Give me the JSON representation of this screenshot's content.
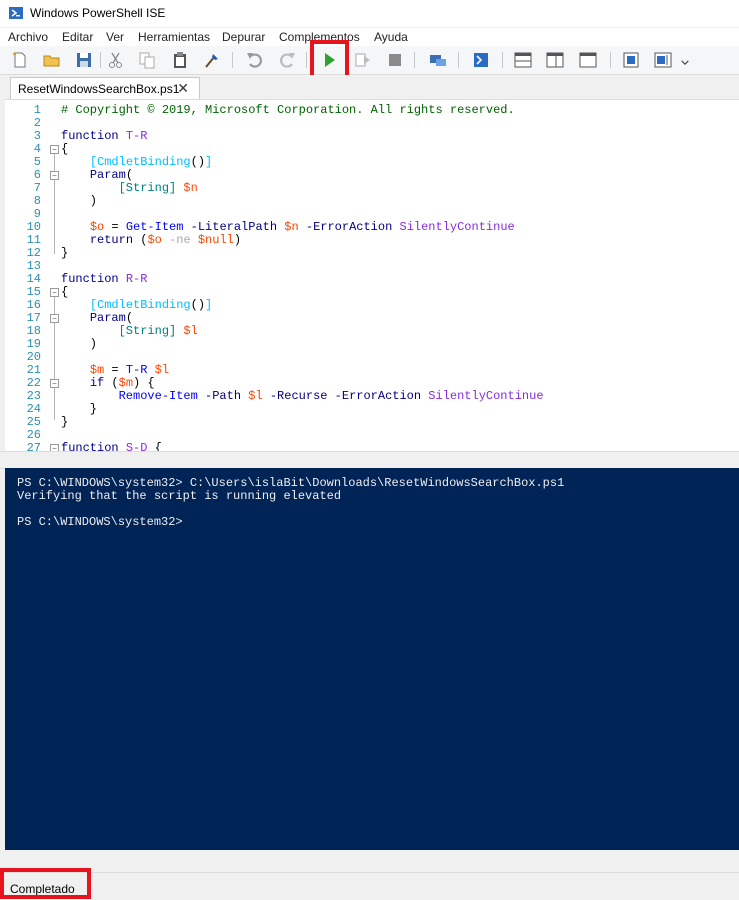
{
  "window": {
    "title": "Windows PowerShell ISE"
  },
  "menu": [
    "Archivo",
    "Editar",
    "Ver",
    "Herramientas",
    "Depurar",
    "Complementos",
    "Ayuda"
  ],
  "toolbar": {
    "icons": [
      "new-icon",
      "open-icon",
      "save-icon",
      "cut-icon",
      "copy-icon",
      "paste-icon",
      "clear-console-icon",
      "undo-icon",
      "redo-icon",
      "run-script-icon",
      "run-selection-icon",
      "stop-icon",
      "remote-powershell-icon",
      "powershell-console-icon",
      "show-script-top-icon",
      "show-script-right-icon",
      "show-script-max-icon",
      "command-addon-icon",
      "show-command-window-icon"
    ]
  },
  "tab": {
    "label": "ResetWindowsSearchBox.ps1",
    "close": "✕"
  },
  "editor": {
    "lines": [
      {
        "n": "1",
        "segs": [
          [
            "comment",
            "# Copyright © 2019, Microsoft Corporation. All rights reserved."
          ]
        ]
      },
      {
        "n": "2",
        "segs": []
      },
      {
        "n": "3",
        "segs": [
          [
            "kw",
            "function "
          ],
          [
            "fn",
            "T-R"
          ]
        ]
      },
      {
        "n": "4",
        "segs": [
          [
            "",
            "{"
          ]
        ]
      },
      {
        "n": "5",
        "segs": [
          [
            "",
            "    "
          ],
          [
            "attr",
            "[CmdletBinding"
          ],
          [
            "",
            "()"
          ],
          [
            "attr",
            "]"
          ]
        ]
      },
      {
        "n": "6",
        "segs": [
          [
            "",
            "    "
          ],
          [
            "kw",
            "Param"
          ],
          [
            "",
            "("
          ]
        ]
      },
      {
        "n": "7",
        "segs": [
          [
            "",
            "        "
          ],
          [
            "type",
            "[String]"
          ],
          [
            "",
            " "
          ],
          [
            "var",
            "$n"
          ]
        ]
      },
      {
        "n": "8",
        "segs": [
          [
            "",
            "    )"
          ]
        ]
      },
      {
        "n": "9",
        "segs": []
      },
      {
        "n": "10",
        "segs": [
          [
            "",
            "    "
          ],
          [
            "var",
            "$o"
          ],
          [
            "",
            " = "
          ],
          [
            "cmd",
            "Get-Item"
          ],
          [
            "",
            " "
          ],
          [
            "param",
            "-LiteralPath"
          ],
          [
            "",
            " "
          ],
          [
            "var",
            "$n"
          ],
          [
            "",
            " "
          ],
          [
            "param",
            "-ErrorAction"
          ],
          [
            "",
            " "
          ],
          [
            "fn",
            "SilentlyContinue"
          ]
        ]
      },
      {
        "n": "11",
        "segs": [
          [
            "",
            "    "
          ],
          [
            "kw",
            "return"
          ],
          [
            "",
            " ("
          ],
          [
            "var",
            "$o"
          ],
          [
            "",
            " "
          ],
          [
            "op",
            "-ne"
          ],
          [
            "",
            " "
          ],
          [
            "var",
            "$null"
          ],
          [
            "",
            ")"
          ]
        ]
      },
      {
        "n": "12",
        "segs": [
          [
            "",
            "}"
          ]
        ]
      },
      {
        "n": "13",
        "segs": []
      },
      {
        "n": "14",
        "segs": [
          [
            "kw",
            "function "
          ],
          [
            "fn",
            "R-R"
          ]
        ]
      },
      {
        "n": "15",
        "segs": [
          [
            "",
            "{"
          ]
        ]
      },
      {
        "n": "16",
        "segs": [
          [
            "",
            "    "
          ],
          [
            "attr",
            "[CmdletBinding"
          ],
          [
            "",
            "()"
          ],
          [
            "attr",
            "]"
          ]
        ]
      },
      {
        "n": "17",
        "segs": [
          [
            "",
            "    "
          ],
          [
            "kw",
            "Param"
          ],
          [
            "",
            "("
          ]
        ]
      },
      {
        "n": "18",
        "segs": [
          [
            "",
            "        "
          ],
          [
            "type",
            "[String]"
          ],
          [
            "",
            " "
          ],
          [
            "var",
            "$l"
          ]
        ]
      },
      {
        "n": "19",
        "segs": [
          [
            "",
            "    )"
          ]
        ]
      },
      {
        "n": "20",
        "segs": []
      },
      {
        "n": "21",
        "segs": [
          [
            "",
            "    "
          ],
          [
            "var",
            "$m"
          ],
          [
            "",
            " = "
          ],
          [
            "cmd",
            "T-R"
          ],
          [
            "",
            " "
          ],
          [
            "var",
            "$l"
          ]
        ]
      },
      {
        "n": "22",
        "segs": [
          [
            "",
            "    "
          ],
          [
            "kw",
            "if"
          ],
          [
            "",
            " ("
          ],
          [
            "var",
            "$m"
          ],
          [
            "",
            ") {"
          ]
        ]
      },
      {
        "n": "23",
        "segs": [
          [
            "",
            "        "
          ],
          [
            "cmd",
            "Remove-Item"
          ],
          [
            "",
            " "
          ],
          [
            "param",
            "-Path"
          ],
          [
            "",
            " "
          ],
          [
            "var",
            "$l"
          ],
          [
            "",
            " "
          ],
          [
            "param",
            "-Recurse"
          ],
          [
            "",
            " "
          ],
          [
            "param",
            "-ErrorAction"
          ],
          [
            "",
            " "
          ],
          [
            "fn",
            "SilentlyContinue"
          ]
        ]
      },
      {
        "n": "24",
        "segs": [
          [
            "",
            "    }"
          ]
        ]
      },
      {
        "n": "25",
        "segs": [
          [
            "",
            "}"
          ]
        ]
      },
      {
        "n": "26",
        "segs": []
      },
      {
        "n": "27",
        "segs": [
          [
            "kw",
            "function "
          ],
          [
            "fn",
            "S-D"
          ],
          [
            "",
            " {"
          ]
        ]
      }
    ]
  },
  "console": {
    "lines": [
      "PS C:\\WINDOWS\\system32> C:\\Users\\islaBit\\Downloads\\ResetWindowsSearchBox.ps1",
      "Verifying that the script is running elevated",
      "",
      "PS C:\\WINDOWS\\system32>"
    ]
  },
  "status": {
    "text": "Completado"
  },
  "colors": {
    "console_bg": "#012456",
    "highlight": "#e8141d"
  }
}
